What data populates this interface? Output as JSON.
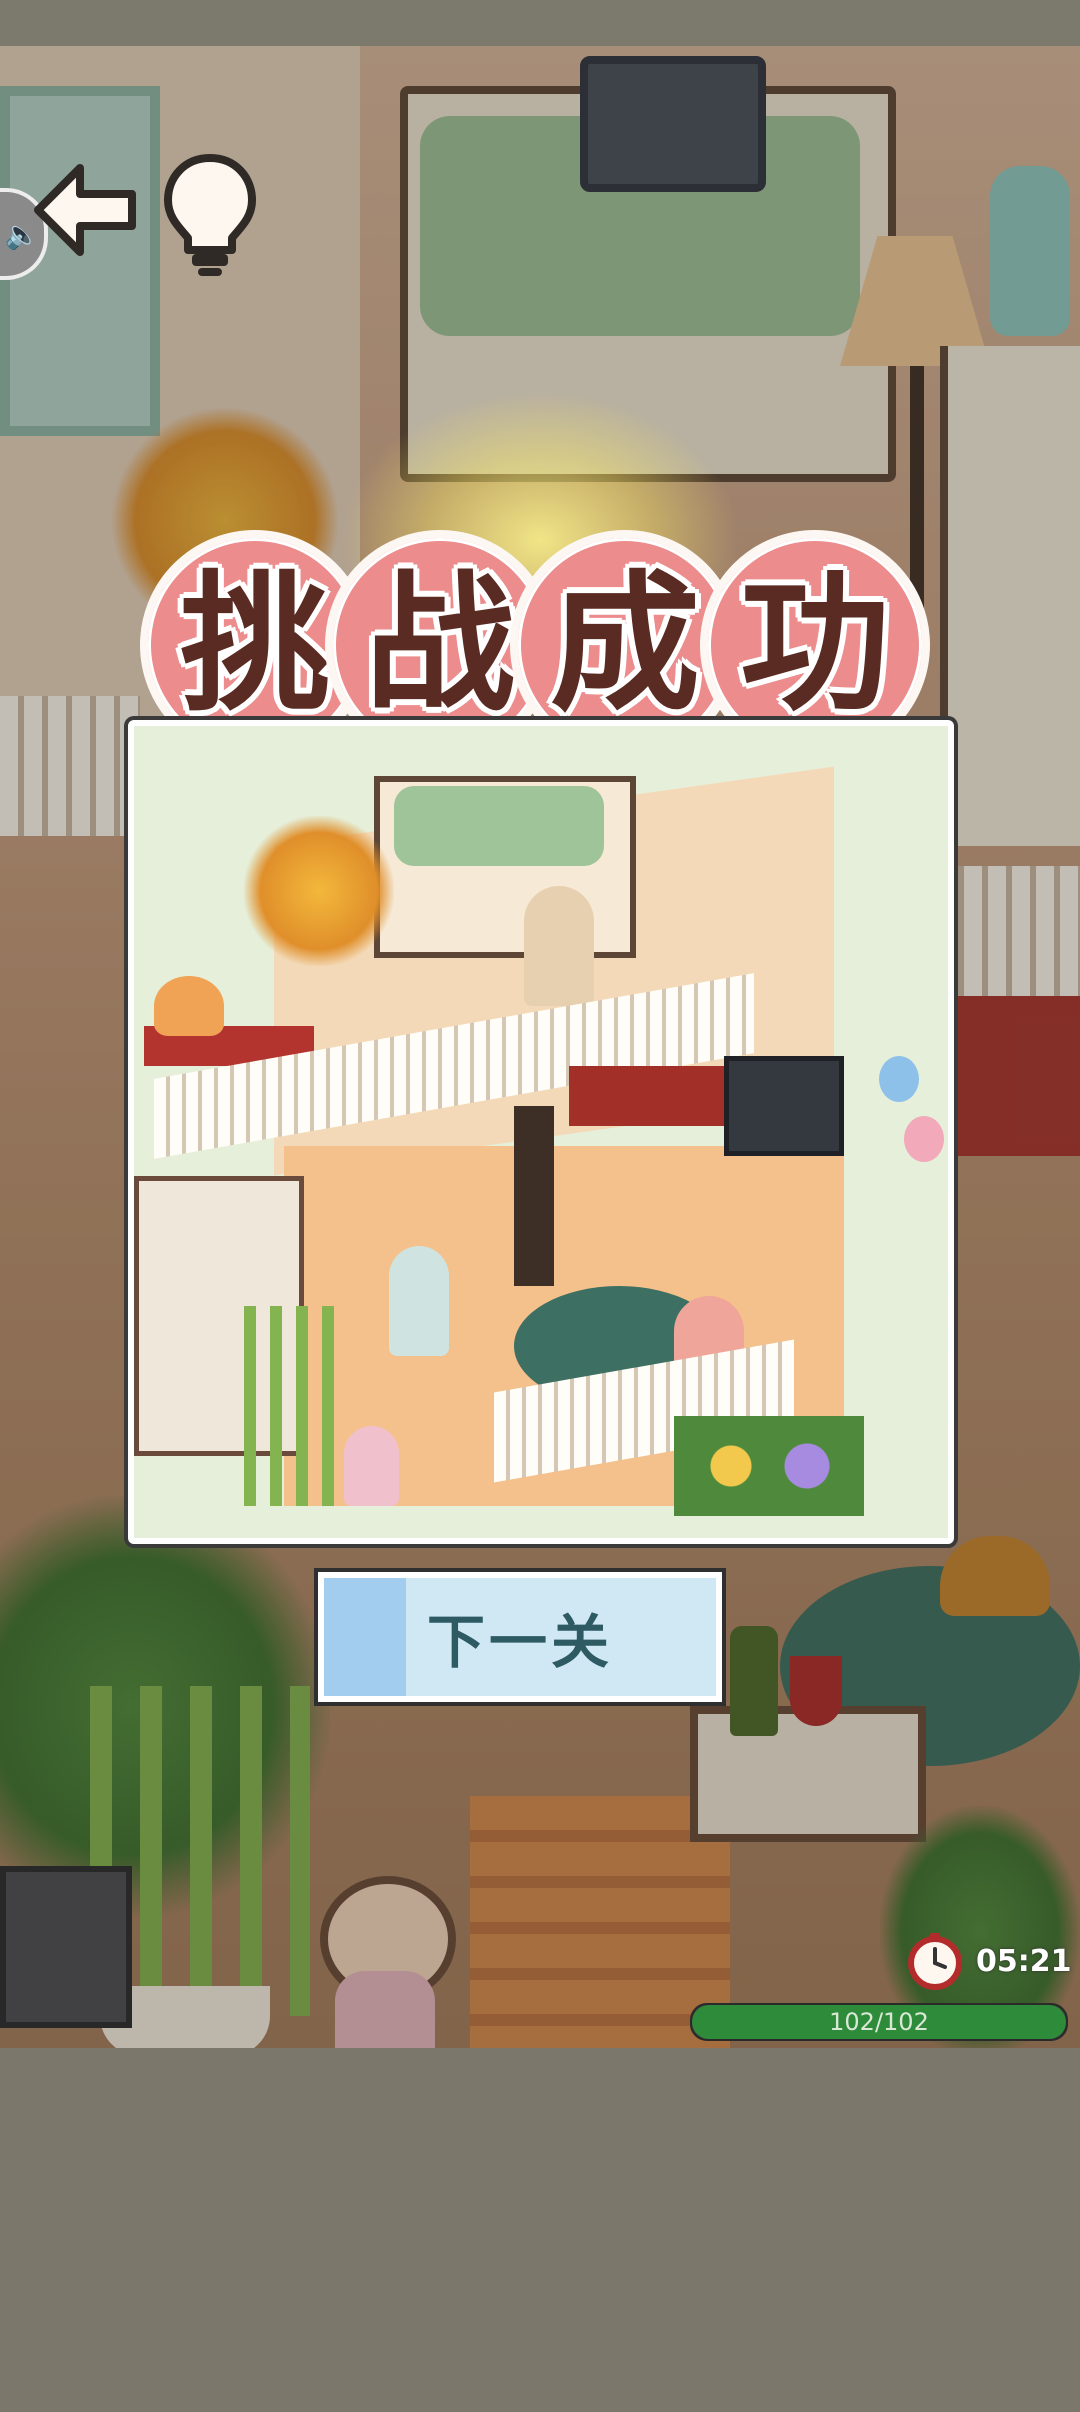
{
  "title": {
    "characters": [
      "挑",
      "战",
      "成",
      "功"
    ]
  },
  "next_button": {
    "label": "下一关"
  },
  "timer": {
    "time": "05:21"
  },
  "progress": {
    "label": "102/102",
    "found": 102,
    "total": 102,
    "fraction": 1.0
  },
  "icons": {
    "sound": "speaker-icon",
    "back": "back-arrow-icon",
    "hint": "lightbulb-icon",
    "clock": "clock-icon"
  },
  "colors": {
    "title_bubble": "#ec8c8c",
    "title_text": "#5a2b22",
    "next_button_bg": "#cfe8f4",
    "next_button_text": "#2d5a63",
    "progress_fill": "#2e8b3a",
    "backdrop": "#7b786b"
  }
}
